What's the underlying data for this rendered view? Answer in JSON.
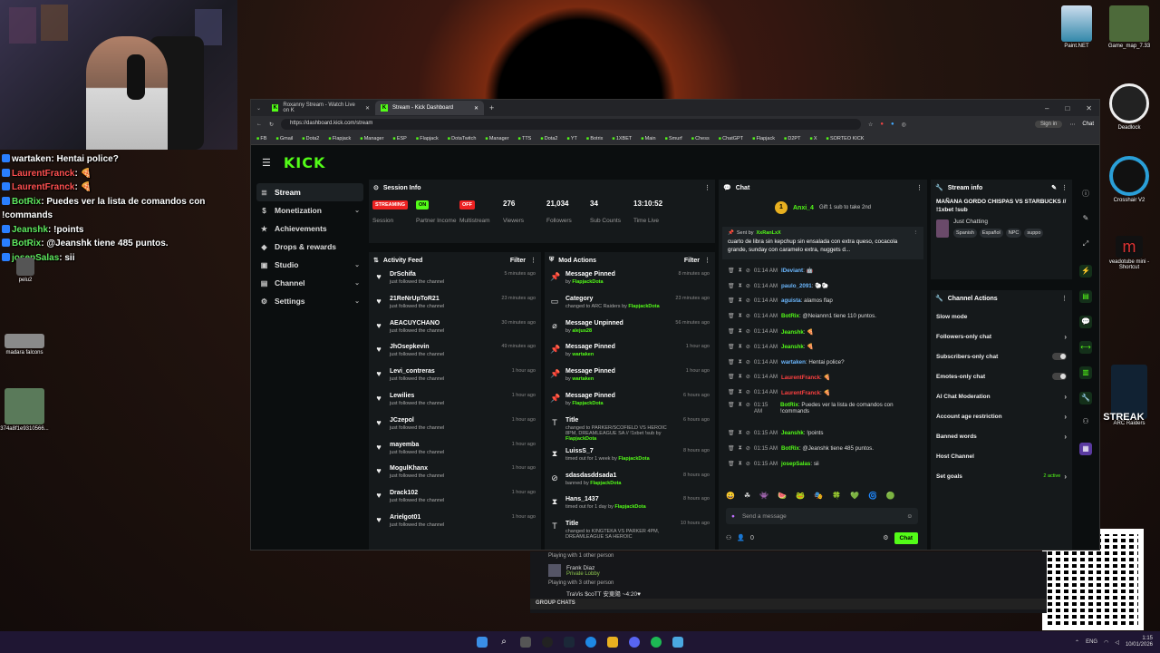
{
  "overlay_chat": [
    {
      "user": "wartaken",
      "msg": ": Hentai police?",
      "color": "#ffffff"
    },
    {
      "user": "LaurentFranck",
      "msg": ": 🍕",
      "color": "#ff5050"
    },
    {
      "user": "LaurentFranck",
      "msg": ": 🍕",
      "color": "#ff5050"
    },
    {
      "user": "BotRix",
      "msg": ": Puedes ver la lista de comandos con",
      "color": "#5ee85e"
    },
    {
      "user": "",
      "msg": "!commands",
      "color": "#ffffff"
    },
    {
      "user": "Jeanshk",
      "msg": ": !points",
      "color": "#5ee85e"
    },
    {
      "user": "BotRix",
      "msg": ": @Jeanshk tiene 485 puntos.",
      "color": "#5ee85e"
    },
    {
      "user": "josepSalas",
      "msg": ": sii",
      "color": "#5ee85e"
    }
  ],
  "desktop": {
    "left": [
      {
        "label": "pelu2"
      },
      {
        "label": "madara falcons"
      },
      {
        "label": "374a8f1e9310566..."
      }
    ],
    "right": [
      {
        "label": "Paint.NET"
      },
      {
        "label": "Game_map_7.33"
      },
      {
        "label": "Deadlock"
      },
      {
        "label": "Crosshair V2"
      },
      {
        "label": "veadotube mini - Shortcut"
      },
      {
        "label": "ARC Raiders"
      }
    ],
    "streak": "8x STREAK"
  },
  "browser": {
    "tabs": [
      {
        "title": "Roxanny Stream - Watch Live on K"
      },
      {
        "title": "Stream - Kick Dashboard"
      }
    ],
    "url": "https://dashboard.kick.com/stream",
    "signin": "Sign in",
    "chat_btn": "Chat",
    "bookmarks": [
      "FB",
      "Gmail",
      "Dota2",
      "Flapjack",
      "Manager",
      "ESP",
      "Flapjack",
      "DotaTwitch",
      "Manager",
      "TTS",
      "Dota2",
      "YT",
      "Botrix",
      "1XBET",
      "Main",
      "Smurf",
      "Chess",
      "ChatGPT",
      "Flapjack",
      "D2PT",
      "X",
      "SORTEO KICK"
    ]
  },
  "kick": {
    "logo": "KICK",
    "nav": [
      {
        "label": "Stream",
        "icon": "≣",
        "chev": false,
        "active": true
      },
      {
        "label": "Monetization",
        "icon": "$",
        "chev": true
      },
      {
        "label": "Achievements",
        "icon": "★",
        "chev": false
      },
      {
        "label": "Drops & rewards",
        "icon": "◆",
        "chev": false
      },
      {
        "label": "Studio",
        "icon": "▣",
        "chev": true
      },
      {
        "label": "Channel",
        "icon": "▤",
        "chev": true
      },
      {
        "label": "Settings",
        "icon": "⚙",
        "chev": true
      }
    ],
    "session": {
      "title": "Session Info",
      "stats": [
        {
          "pill": "STREAMING",
          "pill_color": "red",
          "label": "Session"
        },
        {
          "pill": "ON",
          "pill_color": "green",
          "label": "Partner Income"
        },
        {
          "pill": "OFF",
          "pill_color": "red",
          "label": "Multistream"
        },
        {
          "value": "276",
          "label": "Viewers"
        },
        {
          "value": "21,034",
          "label": "Followers"
        },
        {
          "value": "34",
          "label": "Sub Counts"
        },
        {
          "value": "13:10:52",
          "label": "Time Live"
        }
      ]
    },
    "activity": {
      "title": "Activity Feed",
      "filter": "Filter",
      "items": [
        {
          "name": "DrSchifa",
          "sub": "just followed the channel",
          "time": "5 minutes ago"
        },
        {
          "name": "21ReNrUpToR21",
          "sub": "just followed the channel",
          "time": "23 minutes ago"
        },
        {
          "name": "AEACUYCHANO",
          "sub": "just followed the channel",
          "time": "30 minutes ago"
        },
        {
          "name": "JhOsepkevin",
          "sub": "just followed the channel",
          "time": "49 minutes ago"
        },
        {
          "name": "Levi_contreras",
          "sub": "just followed the channel",
          "time": "1 hour ago"
        },
        {
          "name": "Lewilies",
          "sub": "just followed the channel",
          "time": "1 hour ago"
        },
        {
          "name": "JCzepol",
          "sub": "just followed the channel",
          "time": "1 hour ago"
        },
        {
          "name": "mayemba",
          "sub": "just followed the channel",
          "time": "1 hour ago"
        },
        {
          "name": "MogulKhanx",
          "sub": "just followed the channel",
          "time": "1 hour ago"
        },
        {
          "name": "Drack102",
          "sub": "just followed the channel",
          "time": "1 hour ago"
        },
        {
          "name": "Arielgot01",
          "sub": "just followed the channel",
          "time": "1 hour ago"
        }
      ]
    },
    "mod": {
      "title": "Mod Actions",
      "filter": "Filter",
      "items": [
        {
          "icon": "📌",
          "name": "Message Pinned",
          "pre": "by",
          "who": "FlapjackDota",
          "time": "8 minutes ago"
        },
        {
          "icon": "▭",
          "name": "Category",
          "pre": "changed to ARC Raiders by",
          "who": "FlapjackDota",
          "time": "23 minutes ago"
        },
        {
          "icon": "⌀",
          "name": "Message Unpinned",
          "pre": "by",
          "who": "alejus28",
          "time": "56 minutes ago"
        },
        {
          "icon": "📌",
          "name": "Message Pinned",
          "pre": "by",
          "who": "wartaken",
          "time": "1 hour ago"
        },
        {
          "icon": "📌",
          "name": "Message Pinned",
          "pre": "by",
          "who": "wartaken",
          "time": "1 hour ago"
        },
        {
          "icon": "📌",
          "name": "Message Pinned",
          "pre": "by",
          "who": "FlapjackDota",
          "time": "6 hours ago"
        },
        {
          "icon": "T",
          "name": "Title",
          "pre": "changed to PARKER/SCOFIELD VS HEROIC 8PM, DREAMLEAGUE SA // !1xbet !sub by",
          "who": "FlapjackDota",
          "time": "6 hours ago"
        },
        {
          "icon": "⧗",
          "name": "LuissS_7",
          "pre": "timed out for 1 week by",
          "who": "FlapjackDota",
          "time": "8 hours ago"
        },
        {
          "icon": "⊘",
          "name": "sdasdasddsada1",
          "pre": "banned by",
          "who": "FlapjackDota",
          "time": "8 hours ago"
        },
        {
          "icon": "⧗",
          "name": "Hans_1437",
          "pre": "timed out for 1 day by",
          "who": "FlapjackDota",
          "time": "8 hours ago"
        },
        {
          "icon": "T",
          "name": "Title",
          "pre": "changed to KINGTEKA VS PARKER 4PM, DREAMLEAGUE SA HEROIC",
          "who": "",
          "time": "10 hours ago"
        }
      ]
    },
    "chat": {
      "title": "Chat",
      "gifter": "Anxi_4",
      "gifter_badge": "1",
      "gift_text": "Gift 1 sub to take 2nd",
      "pinned_by_label": "Sent by",
      "pinned_by": "XxRanLxX",
      "pinned_text": "cuarto de libra sin kepchup sin ensalada con extra queso, cocacola grande, sunday con caramelo extra, nuggets d...",
      "messages": [
        {
          "time": "01:14 AM",
          "user": "IDeviant",
          "color": "#6cb8ff",
          "msg": "🤖"
        },
        {
          "time": "01:14 AM",
          "user": "paulo_2091",
          "color": "#6cb8ff",
          "msg": "🐑🐑"
        },
        {
          "time": "01:14 AM",
          "user": "aguista",
          "color": "#6cb8ff",
          "msg": "alamos flap"
        },
        {
          "time": "01:14 AM",
          "user": "BotRix",
          "color": "#53fc18",
          "msg": "@Neiannn1 tiene 110 puntos."
        },
        {
          "time": "01:14 AM",
          "user": "Jeanshk",
          "color": "#53fc18",
          "msg": "🍕"
        },
        {
          "time": "01:14 AM",
          "user": "Jeanshk",
          "color": "#53fc18",
          "msg": "🍕"
        },
        {
          "time": "01:14 AM",
          "user": "wartaken",
          "color": "#6cb8ff",
          "msg": "Hentai police?"
        },
        {
          "time": "01:14 AM",
          "user": "LaurentFranck",
          "color": "#ff4040",
          "msg": "🍕"
        },
        {
          "time": "01:14 AM",
          "user": "LaurentFranck",
          "color": "#ff4040",
          "msg": "🍕"
        },
        {
          "time": "01:15 AM",
          "user": "BotRix",
          "color": "#53fc18",
          "msg": "Puedes ver la lista de comandos con !commands"
        },
        {
          "time": "01:15 AM",
          "user": "Jeanshk",
          "color": "#53fc18",
          "msg": "!points"
        },
        {
          "time": "01:15 AM",
          "user": "BotRix",
          "color": "#53fc18",
          "msg": "@Jeanshk tiene 485 puntos."
        },
        {
          "time": "01:15 AM",
          "user": "josepSalas",
          "color": "#53fc18",
          "msg": "sii"
        }
      ],
      "placeholder": "Send a message",
      "count": "0",
      "send": "Chat"
    },
    "stream_info": {
      "title": "Stream info",
      "stream_title": "MAÑANA GORDO CHISPAS VS STARBUCKS // !1xbet !sub",
      "category": "Just Chatting",
      "tags": [
        "Spanish",
        "Español",
        "NPC",
        "suppo"
      ]
    },
    "channel_actions": {
      "title": "Channel Actions",
      "items": [
        {
          "label": "Slow mode",
          "ctl": "toggle-on"
        },
        {
          "label": "Followers-only chat",
          "ctl": "chev"
        },
        {
          "label": "Subscribers-only chat",
          "ctl": "toggle"
        },
        {
          "label": "Emotes-only chat",
          "ctl": "toggle"
        },
        {
          "label": "AI Chat Moderation",
          "ctl": "chev"
        },
        {
          "label": "Account age restriction",
          "ctl": "chev"
        },
        {
          "label": "Banned words",
          "ctl": "chev"
        },
        {
          "label": "Host Channel",
          "ctl": ""
        },
        {
          "label": "Set goals",
          "ctl": "chev",
          "extra": "2 active"
        }
      ]
    }
  },
  "lower": {
    "rows": [
      {
        "text": "Playing with 1 other person"
      },
      {
        "name": "Frank Diaz",
        "status": "Private Lobby"
      },
      {
        "text": "Playing with 3 other person"
      },
      {
        "name": "TraVis $coTT 安東陽 ~4:20♥",
        "status": ""
      }
    ],
    "group": "GROUP CHATS"
  },
  "taskbar": {
    "lang": "ENG",
    "time": "1:15",
    "date": "10/01/2026"
  },
  "colors": {
    "kick_green": "#53fc18",
    "live_red": "#e22222"
  }
}
